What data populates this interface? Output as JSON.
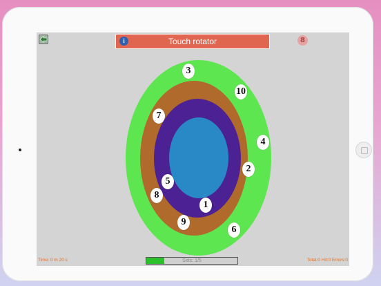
{
  "header": {
    "title": "Touch rotator",
    "info_icon": "i",
    "trophy_icon": "8"
  },
  "targets": [
    "3",
    "10",
    "7",
    "4",
    "2",
    "5",
    "8",
    "1",
    "9",
    "6"
  ],
  "footer": {
    "time": "Time: 0 m 20 s",
    "progress_label": "Sets: 1/5",
    "progress_fraction": 0.2,
    "score": "Total:0 Hit:0 Errors:0"
  },
  "colors": {
    "outer_ring": "#5ee651",
    "second_ring": "#b06a2b",
    "third_ring": "#4b2194",
    "center": "#2989c6",
    "title_bar": "#e0664f",
    "status_text": "#e0702a"
  }
}
